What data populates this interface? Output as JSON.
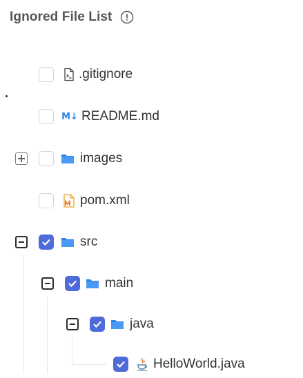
{
  "header": {
    "title": "Ignored File List",
    "info_icon": "info-circle-icon"
  },
  "colors": {
    "checked": "#4f6bd9",
    "folder": "#2f80ed",
    "markdown": "#2f80ed",
    "maven": "#f0a030"
  },
  "tree": [
    {
      "name": ".gitignore",
      "icon": "terminal-file-icon",
      "checked": false,
      "expandable": false
    },
    {
      "name": "README.md",
      "icon": "markdown-icon",
      "icon_text": "M↓",
      "checked": false,
      "expandable": false
    },
    {
      "name": "images",
      "icon": "folder-icon",
      "checked": false,
      "expandable": true,
      "expanded": false
    },
    {
      "name": "pom.xml",
      "icon": "maven-icon",
      "checked": false,
      "expandable": false
    },
    {
      "name": "src",
      "icon": "folder-icon",
      "checked": true,
      "expandable": true,
      "expanded": true
    },
    {
      "name": "main",
      "icon": "folder-icon",
      "checked": true,
      "expandable": true,
      "expanded": true
    },
    {
      "name": "java",
      "icon": "folder-icon",
      "checked": true,
      "expandable": true,
      "expanded": true
    },
    {
      "name": "HelloWorld.java",
      "icon": "java-icon",
      "checked": true,
      "expandable": false
    }
  ]
}
